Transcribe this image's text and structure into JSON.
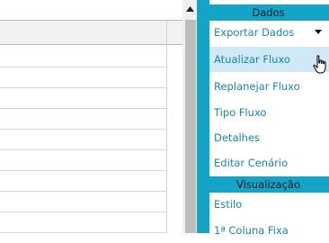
{
  "panel": {
    "accent_color": "#14a4c8",
    "link_color": "#1a86b4",
    "sections": [
      {
        "title": "Dados",
        "items": [
          {
            "label": "Exportar Dados",
            "icon": "dropdown-triangle-icon"
          },
          {
            "label": "Atualizar Fluxo",
            "state": "hover"
          },
          {
            "label": "Replanejar Fluxo"
          },
          {
            "label": "Tipo Fluxo"
          },
          {
            "label": "Detalhes"
          },
          {
            "label": "Editar Cenário"
          }
        ]
      },
      {
        "title": "Visualização",
        "items": [
          {
            "label": "Estilo"
          },
          {
            "label": "1ª Coluna Fixa"
          }
        ]
      }
    ]
  },
  "cursor": {
    "icon": "hand-pointer-icon"
  },
  "scrollbar": {
    "icon": "scroll-up-arrow-icon"
  }
}
